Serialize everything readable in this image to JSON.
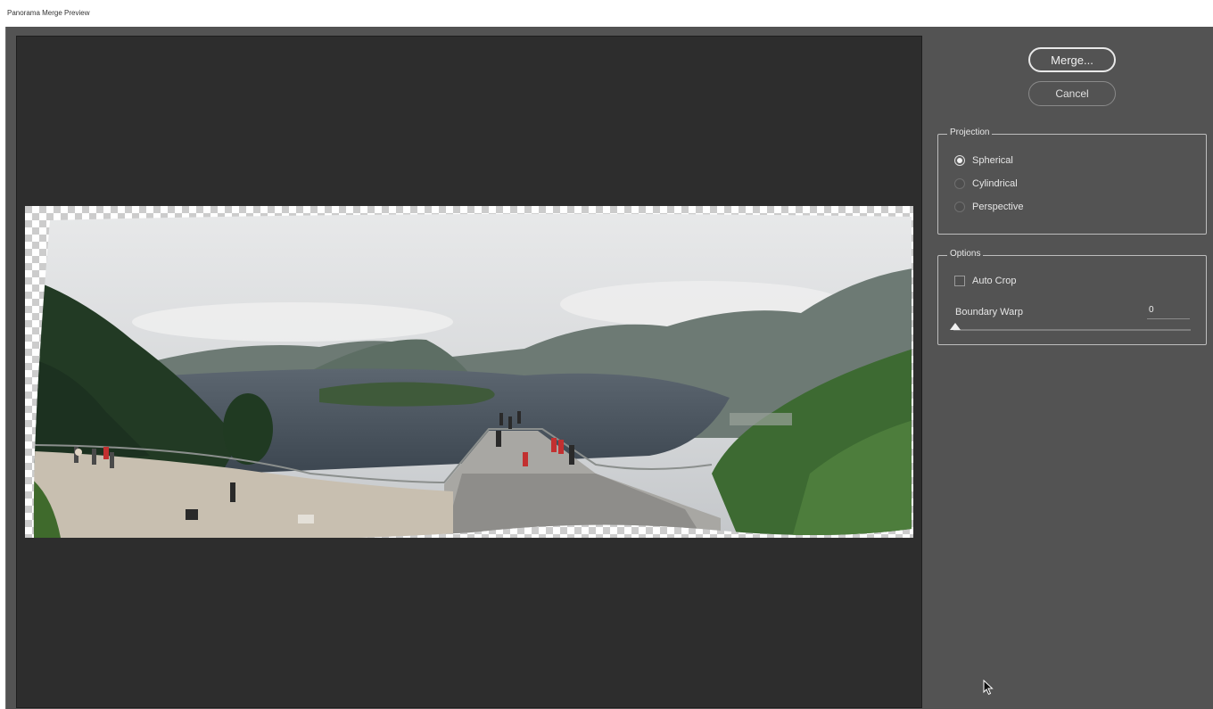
{
  "window": {
    "title": "Panorama Merge Preview"
  },
  "buttons": {
    "merge_label": "Merge...",
    "cancel_label": "Cancel"
  },
  "projection": {
    "group_label": "Projection",
    "options": [
      {
        "label": "Spherical",
        "selected": true
      },
      {
        "label": "Cylindrical",
        "selected": false
      },
      {
        "label": "Perspective",
        "selected": false
      }
    ]
  },
  "options": {
    "group_label": "Options",
    "auto_crop_label": "Auto Crop",
    "auto_crop_checked": false,
    "boundary_warp_label": "Boundary Warp",
    "boundary_warp_value": "0"
  },
  "colors": {
    "dialog_bg": "#535353",
    "preview_bg": "#2d2d2d",
    "text": "#e6e6e6"
  }
}
